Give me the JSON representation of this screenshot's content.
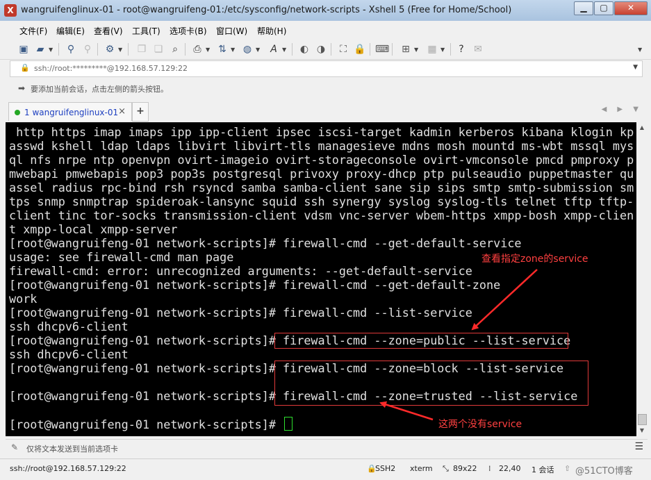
{
  "window": {
    "title": "wangruifenglinux-01 - root@wangruifeng-01:/etc/sysconfig/network-scripts - Xshell 5 (Free for Home/School)",
    "buttons": {
      "minimize": "▁",
      "maximize": "▢",
      "close": "✕"
    }
  },
  "menu": [
    "文件(F)",
    "编辑(E)",
    "查看(V)",
    "工具(T)",
    "选项卡(B)",
    "窗口(W)",
    "帮助(H)"
  ],
  "address": {
    "value": "ssh://root:*********@192.168.57.129:22"
  },
  "hint": {
    "text": "要添加当前会话，点击左侧的箭头按钮。"
  },
  "tab": {
    "label": "1 wangruifenglinux-01",
    "close": "×",
    "add": "+",
    "nav": "◀ ▶ ▼"
  },
  "terminal": {
    "lines": [
      " http https imap imaps ipp ipp-client ipsec iscsi-target kadmin kerberos kibana klogin kp",
      "asswd kshell ldap ldaps libvirt libvirt-tls managesieve mdns mosh mountd ms-wbt mssql mys",
      "ql nfs nrpe ntp openvpn ovirt-imageio ovirt-storageconsole ovirt-vmconsole pmcd pmproxy p",
      "mwebapi pmwebapis pop3 pop3s postgresql privoxy proxy-dhcp ptp pulseaudio puppetmaster qu",
      "assel radius rpc-bind rsh rsyncd samba samba-client sane sip sips smtp smtp-submission sm",
      "tps snmp snmptrap spideroak-lansync squid ssh synergy syslog syslog-tls telnet tftp tftp-",
      "client tinc tor-socks transmission-client vdsm vnc-server wbem-https xmpp-bosh xmpp-clien",
      "t xmpp-local xmpp-server",
      "[root@wangruifeng-01 network-scripts]# firewall-cmd --get-default-service",
      "usage: see firewall-cmd man page",
      "firewall-cmd: error: unrecognized arguments: --get-default-service",
      "[root@wangruifeng-01 network-scripts]# firewall-cmd --get-default-zone",
      "work",
      "[root@wangruifeng-01 network-scripts]# firewall-cmd --list-service",
      "ssh dhcpv6-client",
      "[root@wangruifeng-01 network-scripts]# firewall-cmd --zone=public --list-service",
      "ssh dhcpv6-client",
      "[root@wangruifeng-01 network-scripts]# firewall-cmd --zone=block --list-service",
      "",
      "[root@wangruifeng-01 network-scripts]# firewall-cmd --zone=trusted --list-service",
      "",
      "[root@wangruifeng-01 network-scripts]# "
    ]
  },
  "annotations": {
    "zone_service": "查看指定zone的service",
    "no_service": "这两个没有service"
  },
  "input": {
    "placeholder": "仅将文本发送到当前选项卡"
  },
  "status": {
    "connection": "ssh://root@192.168.57.129:22",
    "protocol": "SSH2",
    "term": "xterm",
    "size": "89x22",
    "cursor": "22,40",
    "sessions": "1 会话",
    "watermark": "@51CTO博客"
  },
  "colors": {
    "annotation": "#ff4040",
    "cursor": "#2ee02e",
    "tab_dot": "#26a826"
  }
}
